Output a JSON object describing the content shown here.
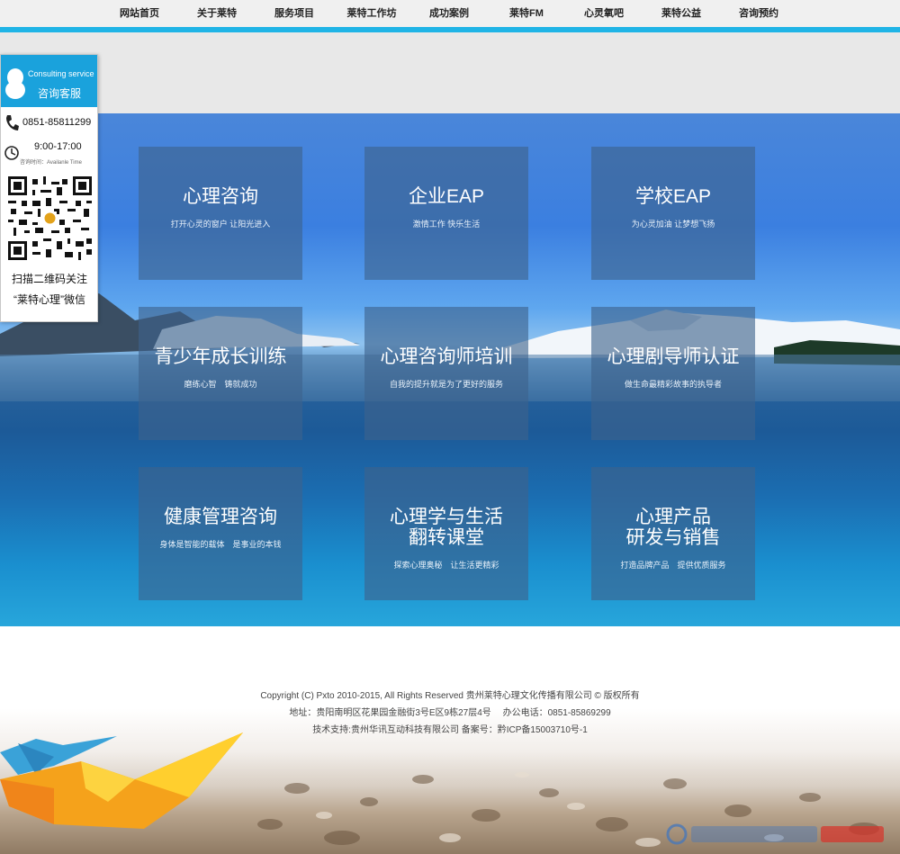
{
  "nav": {
    "items": [
      "网站首页",
      "关于莱特",
      "服务项目",
      "莱特工作坊",
      "成功案例",
      "莱特FM",
      "心灵氧吧",
      "莱特公益",
      "咨询预约"
    ]
  },
  "consult": {
    "title_en": "Consulting service",
    "title_cn": "咨询客服",
    "phone": "0851-85811299",
    "hours": "9:00-17:00",
    "hours_label": "咨询时间：Availanle Time",
    "scan_line1": "扫描二维码关注",
    "scan_line2": "“莱特心理”微信"
  },
  "tiles": [
    {
      "title": "心理咨询",
      "sub": "打开心灵的窗户 让阳光进入"
    },
    {
      "title": "企业EAP",
      "sub": "激情工作 快乐生活"
    },
    {
      "title": "学校EAP",
      "sub": "为心灵加油 让梦想飞扬"
    },
    {
      "title": "青少年成长训练",
      "sub": "磨练心智　铸就成功"
    },
    {
      "title": "心理咨询师培训",
      "sub": "自我的提升就是为了更好的服务"
    },
    {
      "title": "心理剧导师认证",
      "sub": "做生命最精彩故事的执导者"
    },
    {
      "title": "健康管理咨询",
      "sub": "身体是智能的载体　是事业的本钱"
    },
    {
      "title": "心理学与生活",
      "title2": "翻转课堂",
      "sub": "探索心理奥秘　让生活更精彩"
    },
    {
      "title": "心理产品",
      "title2": "研发与销售",
      "sub": "打造品牌产品　提供优质服务"
    }
  ],
  "footer": {
    "copyright": "Copyright (C) Pxto 2010-2015, All Rights Reserved 贵州莱特心理文化传播有限公司 © 版权所有",
    "address": "地址：贵阳南明区花果园金融街3号E区9栋27层4号　 办公电话：0851-85869299",
    "support": "技术支持:贵州华讯互动科技有限公司 备案号：黔ICP备15003710号-1"
  },
  "colors": {
    "accent": "#1fb4e6",
    "consult_head": "#1aa2dc",
    "tile": "#3e628c"
  }
}
